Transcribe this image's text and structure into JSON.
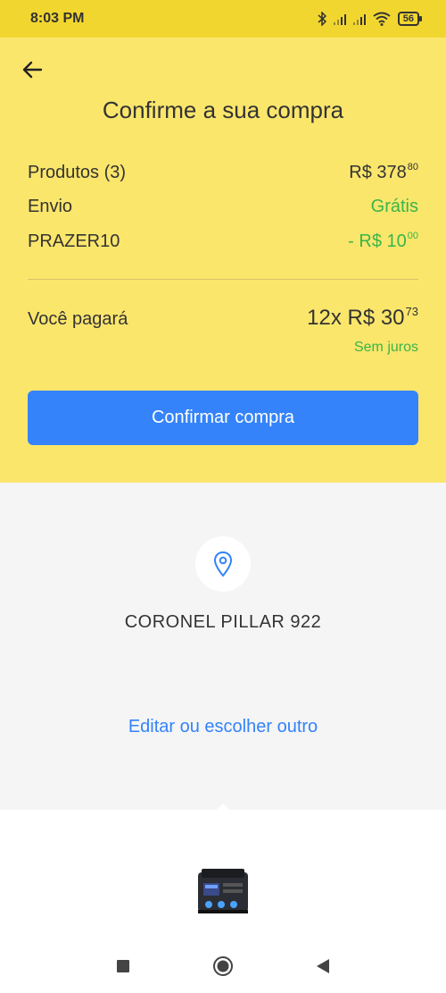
{
  "status_bar": {
    "time": "8:03 PM",
    "battery": "56"
  },
  "header": {
    "title": "Confirme a sua compra"
  },
  "summary": {
    "products_label": "Produtos (3)",
    "products_price_main": "R$ 378",
    "products_price_cents": "80",
    "shipping_label": "Envio",
    "shipping_value": "Grátis",
    "coupon_label": "PRAZER10",
    "coupon_value_main": "- R$ 10",
    "coupon_value_cents": "00"
  },
  "payment": {
    "label": "Você pagará",
    "amount_main": "12x R$ 30",
    "amount_cents": "73",
    "interest": "Sem juros"
  },
  "confirm_button": "Confirmar compra",
  "address": {
    "text": "CORONEL PILLAR 922",
    "edit_link": "Editar ou escolher outro"
  },
  "colors": {
    "status_bar": "#f2d630",
    "header_bg": "#fbe66c",
    "primary": "#3483fa",
    "green": "#39b54a"
  },
  "icons": [
    "back-arrow-icon",
    "location-pin-icon",
    "product-image",
    "nav-recents-icon",
    "nav-home-icon",
    "nav-back-icon"
  ]
}
